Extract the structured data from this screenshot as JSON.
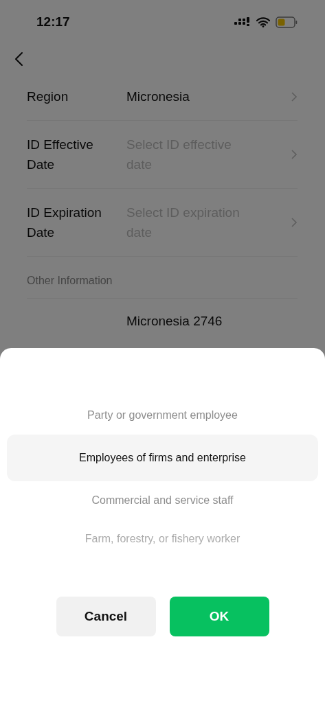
{
  "status_bar": {
    "time": "12:17"
  },
  "form": {
    "rows": [
      {
        "label": "Region",
        "value": "Micronesia"
      },
      {
        "label": "ID Effective Date",
        "placeholder": "Select ID effective date"
      },
      {
        "label": "ID Expiration Date",
        "placeholder": "Select ID expiration date"
      }
    ],
    "section": "Other Information",
    "partial_value": "Micronesia 2746"
  },
  "picker": {
    "options": [
      {
        "label": "Party or government employee",
        "selected": false
      },
      {
        "label": "Employees of firms and enterprise",
        "selected": true
      },
      {
        "label": "Commercial and service staff",
        "selected": false
      },
      {
        "label": "Farm, forestry, or fishery worker",
        "selected": false
      }
    ],
    "buttons": [
      {
        "label": "Cancel",
        "kind": "cancel"
      },
      {
        "label": "OK",
        "kind": "confirm"
      }
    ]
  }
}
